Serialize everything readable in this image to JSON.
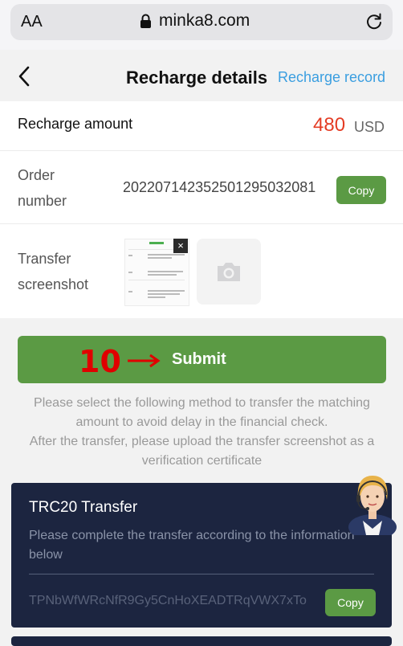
{
  "browser": {
    "text_size": "AA",
    "url": "minka8.com"
  },
  "header": {
    "title": "Recharge details",
    "record_link": "Recharge record"
  },
  "recharge": {
    "amount_label": "Recharge amount",
    "amount": "480",
    "currency": "USD",
    "order_label_1": "Order",
    "order_label_2": "number",
    "order_number": "20220714235250129503208​1",
    "copy_label": "Copy",
    "screenshot_label_1": "Transfer",
    "screenshot_label_2": "screenshot",
    "thumb_close": "×"
  },
  "submit": {
    "label": "Submit",
    "annotation_number": "10",
    "annotation_arrow": "→"
  },
  "notice": {
    "line1": "Please select the following method to transfer the matching amount to avoid delay in the financial check.",
    "line2": "After the transfer, please upload the transfer screenshot as a verification certificate"
  },
  "trc20": {
    "title": "TRC20 Transfer",
    "description": "Please complete the transfer according to the information below",
    "address": "TPNbWfWRcNfR9Gy5CnHoXEADTRqVWX7xTo",
    "copy_label": "Copy"
  },
  "colors": {
    "accent_green": "#5b9a44",
    "amount_red": "#e43c24",
    "link_blue": "#3a9ee0",
    "dark_card": "#1c2540"
  },
  "icons": [
    "lock-icon",
    "reload-icon",
    "back-chevron-icon",
    "camera-icon",
    "close-icon",
    "support-agent-avatar"
  ]
}
